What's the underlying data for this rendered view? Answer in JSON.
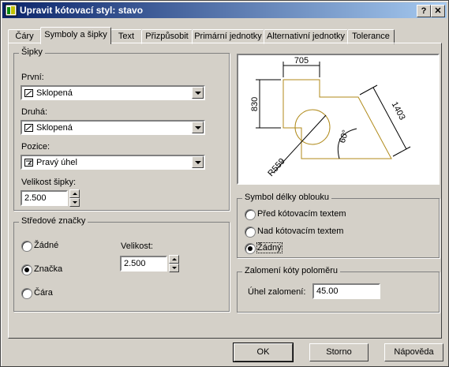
{
  "window": {
    "title": "Upravit kótovací styl: stavo",
    "help_btn": "?",
    "close_btn": "✕"
  },
  "tabs": [
    {
      "label": "Čáry"
    },
    {
      "label": "Symboly a šipky"
    },
    {
      "label": "Text"
    },
    {
      "label": "Přizpůsobit"
    },
    {
      "label": "Primární jednotky"
    },
    {
      "label": "Alternativní jednotky"
    },
    {
      "label": "Tolerance"
    }
  ],
  "arrows": {
    "group_title": "Šipky",
    "first_label": "První:",
    "first_value": "Sklopená",
    "second_label": "Druhá:",
    "second_value": "Sklopená",
    "leader_label": "Pozice:",
    "leader_value": "Pravý úhel",
    "size_label": "Velikost šipky:",
    "size_value": "2.500"
  },
  "center_marks": {
    "group_title": "Středové značky",
    "none": "Žádné",
    "mark": "Značka",
    "line": "Čára",
    "selected": "mark",
    "size_label": "Velikost:",
    "size_value": "2.500"
  },
  "preview": {
    "dim_top": "705",
    "dim_left": "830",
    "dim_right": "1403",
    "dim_angle": "60°",
    "dim_radius": "R559"
  },
  "arc_length": {
    "group_title": "Symbol délky oblouku",
    "before": "Před kótovacím textem",
    "above": "Nad kótovacím textem",
    "none": "Žádný",
    "selected": "none"
  },
  "jog": {
    "group_title": "Zalomení kóty poloměru",
    "angle_label": "Úhel zalomení:",
    "angle_value": "45.00"
  },
  "buttons": {
    "ok": "OK",
    "cancel": "Storno",
    "help": "Nápověda"
  }
}
